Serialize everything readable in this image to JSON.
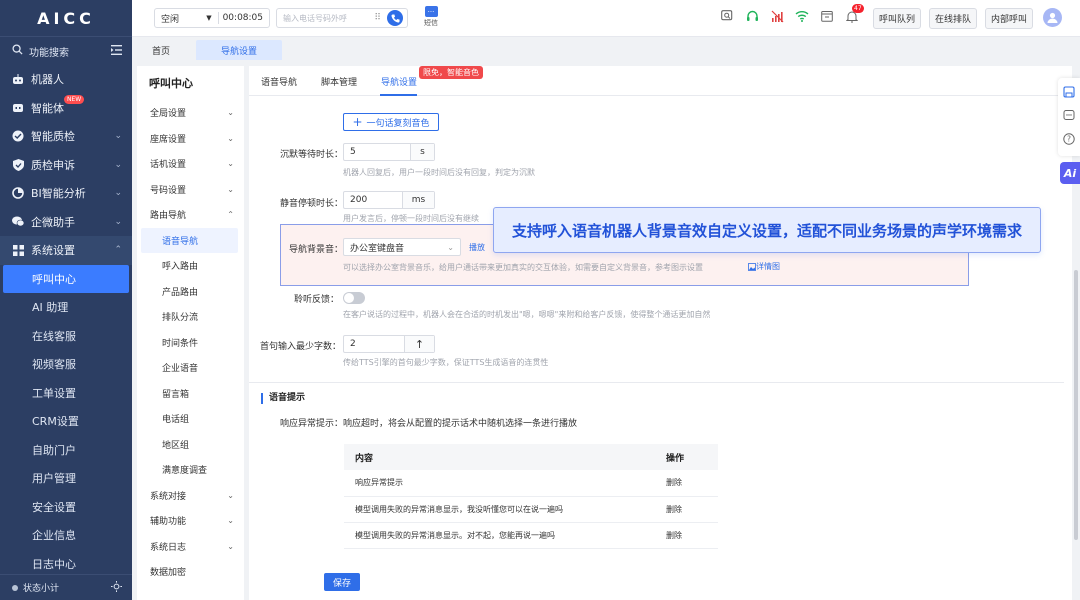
{
  "app": {
    "logo": "AICC"
  },
  "leftnav": {
    "search_label": "功能搜索",
    "items": [
      {
        "label": "机器人",
        "icon": "robot-icon",
        "has_chevron": false
      },
      {
        "label": "智能体",
        "icon": "agent-icon",
        "badge": "NEW",
        "has_chevron": false
      },
      {
        "label": "智能质检",
        "icon": "quality-icon",
        "has_chevron": true
      },
      {
        "label": "质检申诉",
        "icon": "shield-icon",
        "has_chevron": true
      },
      {
        "label": "BI智能分析",
        "icon": "pie-chart-icon",
        "has_chevron": true
      },
      {
        "label": "企微助手",
        "icon": "wechat-icon",
        "has_chevron": true
      },
      {
        "label": "系统设置",
        "icon": "grid-icon",
        "has_chevron": true,
        "expanded": true
      }
    ],
    "sub_items": [
      {
        "label": "呼叫中心",
        "active": true
      },
      {
        "label": "AI 助理"
      },
      {
        "label": "在线客服"
      },
      {
        "label": "视频客服"
      },
      {
        "label": "工单设置"
      },
      {
        "label": "CRM设置"
      },
      {
        "label": "自助门户"
      },
      {
        "label": "用户管理"
      },
      {
        "label": "安全设置"
      },
      {
        "label": "企业信息"
      },
      {
        "label": "日志中心"
      }
    ],
    "footer_label": "状态小计"
  },
  "topbar": {
    "status": "空闲",
    "timer": "00:08:05",
    "phone_placeholder": "输入电话号码外呼",
    "sms_label": "短信",
    "notification_count": "47",
    "buttons": [
      "呼叫队列",
      "在线排队",
      "内部呼叫"
    ]
  },
  "tabstrip": {
    "tabs": [
      "首页",
      "导航设置"
    ],
    "active_index": 1
  },
  "subnav": {
    "title": "呼叫中心",
    "groups_top": [
      {
        "label": "全局设置",
        "chevron": "down"
      },
      {
        "label": "座席设置",
        "chevron": "down"
      },
      {
        "label": "话机设置",
        "chevron": "down"
      },
      {
        "label": "号码设置",
        "chevron": "down"
      },
      {
        "label": "路由导航",
        "chevron": "up"
      }
    ],
    "route_children": [
      "语音导航",
      "呼入路由",
      "产品路由",
      "排队分流",
      "时间条件",
      "企业语音",
      "留言箱",
      "电话组",
      "地区组",
      "满意度调查"
    ],
    "active_child": "语音导航",
    "groups_bottom": [
      {
        "label": "系统对接",
        "chevron": "down"
      },
      {
        "label": "辅助功能",
        "chevron": "down"
      },
      {
        "label": "系统日志",
        "chevron": "down"
      },
      {
        "label": "数据加密",
        "chevron": ""
      }
    ]
  },
  "main": {
    "tabs": [
      "语音导航",
      "脚本管理",
      "导航设置"
    ],
    "active_tab": 2,
    "tab_tag": "限免，智能音色",
    "clone_button": "一句话复刻音色",
    "silence_wait": {
      "label": "沉默等待时长：",
      "value": "5",
      "unit": "s",
      "help": "机器人回复后，用户一段时间后没有回复，判定为沉默"
    },
    "pause": {
      "label": "静音停顿时长：",
      "value": "200",
      "unit": "ms",
      "help": "用户发言后，停顿一段时间后没有继续"
    },
    "bg_sound": {
      "label": "导航背景音：",
      "value": "办公室键盘音",
      "play": "播放",
      "help": "可以选择办公室背景音乐，给用户通话带来更加真实的交互体验，如需要自定义背景音，参考图示设置",
      "detail_link": "详情图"
    },
    "listen": {
      "label": "聆听反馈：",
      "enabled": false,
      "help": "在客户说话的过程中，机器人会在合适的时机发出\"嗯，嗯嗯\"来附和给客户反馈，使得整个通话更加自然"
    },
    "first_min": {
      "label": "首句输入最少字数：",
      "value": "2",
      "help": "传给TTS引擎的首句最少字数，保证TTS生成语音的连贯性"
    },
    "callout": "支持呼入语音机器人背景音效自定义设置，适配不同业务场景的声学环境需求",
    "voice_tips": {
      "section_title": "语音提示",
      "label": "响应异常提示：",
      "desc": "响应超时，将会从配置的提示话术中随机选择一条进行播放",
      "columns": [
        "内容",
        "操作"
      ],
      "rows": [
        {
          "content": "响应异常提示",
          "action": "删除"
        },
        {
          "content": "模型调用失败的异常消息显示，我没听懂您可以在说一遍吗",
          "action": "删除"
        },
        {
          "content": "模型调用失败的异常消息显示。对不起，您能再说一遍吗",
          "action": "删除"
        }
      ]
    },
    "save_button": "保存"
  },
  "colors": {
    "nav_bg": "#2c3e63",
    "accent": "#2f6ee8",
    "active_nav": "#3b7cff",
    "danger": "#f0494b"
  }
}
